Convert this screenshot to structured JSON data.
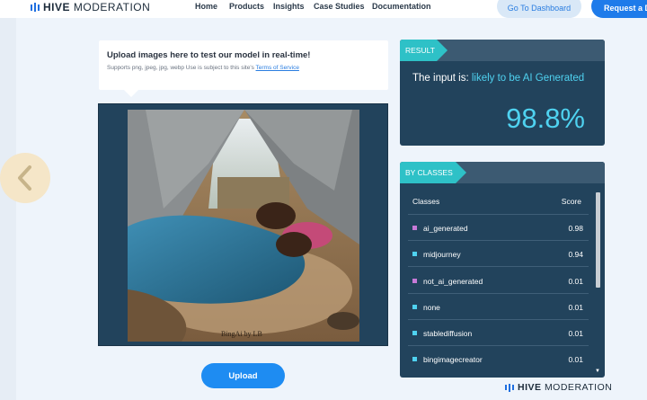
{
  "header": {
    "logo_bold": "HIVE",
    "logo_light": "MODERATION",
    "nav": [
      "Home",
      "Products",
      "Insights",
      "Case Studies",
      "Documentation"
    ],
    "dashboard_button": "Go To Dashboard",
    "request_button": "Request a D"
  },
  "upload": {
    "title": "Upload images here to test our model in real-time!",
    "subtitle": "Supports png, jpeg, jpg, webp Use is subject to this site's ",
    "terms_link": "Terms of Service",
    "button": "Upload",
    "image_watermark": "BingAi by LB"
  },
  "result": {
    "tag": "RESULT",
    "prefix": "The input is: ",
    "verdict": "likely to be AI Generated",
    "percentage": "98.8%"
  },
  "classes": {
    "tag": "BY CLASSES",
    "col_class": "Classes",
    "col_score": "Score",
    "rows": [
      {
        "name": "ai_generated",
        "score": "0.98",
        "color": "#c77ad8"
      },
      {
        "name": "midjourney",
        "score": "0.94",
        "color": "#4fd2f0"
      },
      {
        "name": "not_ai_generated",
        "score": "0.01",
        "color": "#c77ad8"
      },
      {
        "name": "none",
        "score": "0.01",
        "color": "#4fd2f0"
      },
      {
        "name": "stablediffusion",
        "score": "0.01",
        "color": "#4fd2f0"
      },
      {
        "name": "bingimagecreator",
        "score": "0.01",
        "color": "#4fd2f0"
      }
    ]
  },
  "footer": {
    "logo_bold": "HIVE",
    "logo_light": "MODERATION"
  },
  "colors": {
    "accent": "#1e7bea",
    "card_bg": "#22435c",
    "tag_teal": "#2ec1c7",
    "highlight": "#4fd2f0"
  },
  "icons": [
    "hive-logo-icon",
    "chevron-left-icon",
    "scroll-down-icon"
  ]
}
